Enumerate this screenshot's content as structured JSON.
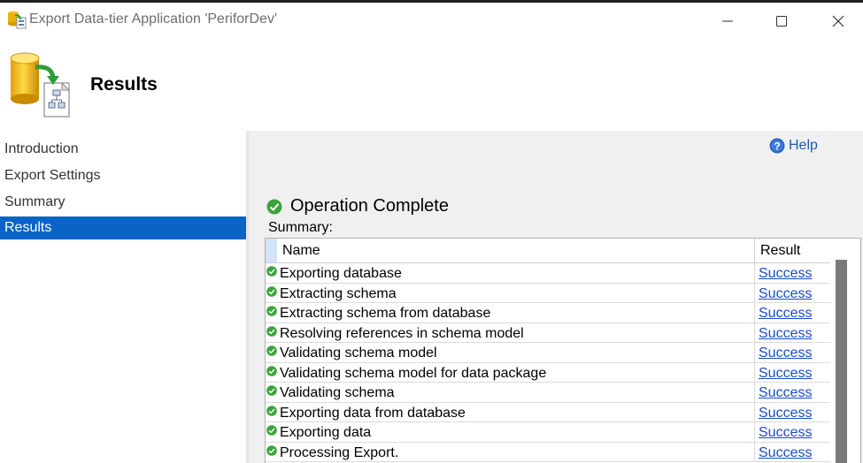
{
  "window": {
    "title": "Export Data-tier Application 'PeriforDev'",
    "controls": [
      "minimize",
      "maximize",
      "close"
    ]
  },
  "header": {
    "title": "Results"
  },
  "nav": {
    "items": [
      {
        "label": "Introduction",
        "active": false
      },
      {
        "label": "Export Settings",
        "active": false
      },
      {
        "label": "Summary",
        "active": false
      },
      {
        "label": "Results",
        "active": true
      }
    ]
  },
  "content": {
    "help_label": "Help",
    "operation_title": "Operation Complete",
    "summary_label": "Summary:",
    "grid": {
      "columns": [
        "Name",
        "Result"
      ],
      "rows": [
        {
          "name": "Exporting database",
          "result": "Success"
        },
        {
          "name": "Extracting schema",
          "result": "Success"
        },
        {
          "name": "Extracting schema from database",
          "result": "Success"
        },
        {
          "name": "Resolving references in schema model",
          "result": "Success"
        },
        {
          "name": "Validating schema model",
          "result": "Success"
        },
        {
          "name": "Validating schema model for data package",
          "result": "Success"
        },
        {
          "name": "Validating schema",
          "result": "Success"
        },
        {
          "name": "Exporting data from database",
          "result": "Success"
        },
        {
          "name": "Exporting data",
          "result": "Success"
        },
        {
          "name": "Processing Export.",
          "result": "Success"
        }
      ]
    }
  },
  "colors": {
    "accent": "#0a64c8",
    "link": "#1a4cc8",
    "success": "#3aa53a"
  },
  "icons": {
    "app": "database-export-icon",
    "header": "database-export-large-icon",
    "help": "help-icon",
    "row_status": "success-check-icon"
  }
}
